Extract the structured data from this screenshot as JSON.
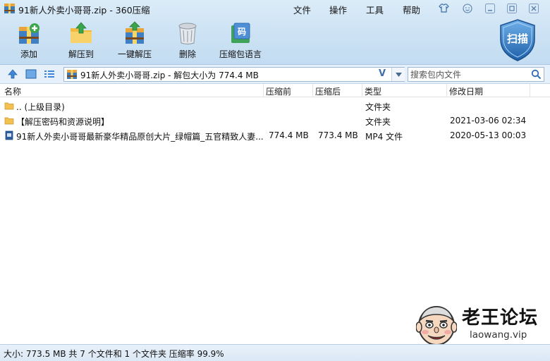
{
  "window": {
    "title": "91新人外卖小哥哥.zip - 360压缩",
    "menu": [
      "文件",
      "操作",
      "工具",
      "帮助"
    ]
  },
  "toolbar": {
    "add": "添加",
    "extract_to": "解压到",
    "one_click": "一键解压",
    "delete": "删除",
    "language": "压缩包语言",
    "scan": "扫描"
  },
  "address": {
    "path": "91新人外卖小哥哥.zip - 解包大小为 774.4 MB",
    "verify": "V"
  },
  "search": {
    "placeholder": "搜索包内文件"
  },
  "columns": {
    "name": "名称",
    "before": "压缩前",
    "after": "压缩后",
    "type": "类型",
    "modified": "修改日期"
  },
  "files": [
    {
      "name": ".. (上级目录)",
      "before": "",
      "after": "",
      "type": "文件夹",
      "modified": ""
    },
    {
      "name": "【解压密码和资源说明】",
      "before": "",
      "after": "",
      "type": "文件夹",
      "modified": "2021-03-06 02:34"
    },
    {
      "name": "91新人外卖小哥哥最新豪华精品原创大片_绿帽篇_五官精致人妻...",
      "before": "774.4 MB",
      "after": "773.4 MB",
      "type": "MP4 文件",
      "modified": "2020-05-13 00:03"
    }
  ],
  "status": "大小: 773.5 MB 共 7 个文件和 1 个文件夹 压缩率 99.9%",
  "watermark": {
    "title": "老王论坛",
    "subtitle": "laowang.vip"
  },
  "colors": {
    "chrome": "#cfe4f5",
    "accent": "#2f6db0",
    "folder": "#f2c14e"
  }
}
